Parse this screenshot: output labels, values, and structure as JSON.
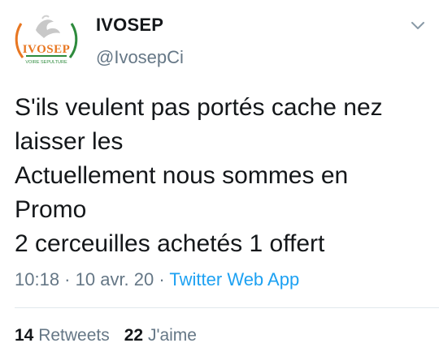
{
  "user": {
    "display_name": "IVOSEP",
    "handle": "@IvosepCi",
    "avatar_text": "IVOSEP",
    "avatar_subtext": "VOIRE SEPULTURE"
  },
  "tweet": {
    "lines": [
      "S'ils veulent pas portés cache nez",
      "laisser les",
      "Actuellement nous sommes en",
      "Promo",
      "2 cerceuilles achetés 1 offert"
    ]
  },
  "meta": {
    "time": "10:18",
    "sep1": " · ",
    "date": "10 avr. 20",
    "sep2": " · ",
    "source": "Twitter Web App"
  },
  "stats": {
    "retweets_count": "14",
    "retweets_label": "Retweets",
    "likes_count": "22",
    "likes_label": "J'aime"
  },
  "colors": {
    "text": "#14171a",
    "secondary": "#657786",
    "link": "#1da1f2",
    "divider": "#e1e8ed",
    "logo_orange": "#e87722",
    "logo_green": "#2e8b3d"
  },
  "icons": {
    "menu": "chevron-down-icon"
  }
}
